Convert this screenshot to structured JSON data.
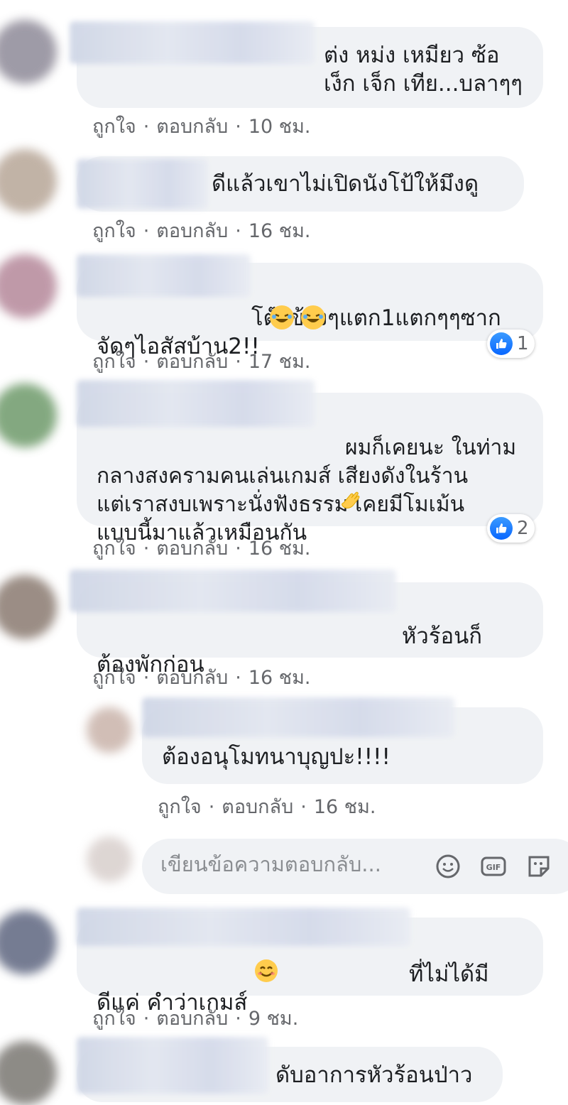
{
  "comments": [
    {
      "text": "ต่ง หม่ง เหมียว ซ้อ\nเง็ก เจ็ก เทีย...บลาๆๆ",
      "like_label": "ถูกใจ",
      "reply_label": "ตอบกลับ",
      "time": "10 ชม."
    },
    {
      "text": "ดีแล้วเขาไม่เปิดนังโป้ให้มึงดู",
      "like_label": "ถูกใจ",
      "reply_label": "ตอบกลับ",
      "time": "16 ชม."
    },
    {
      "text": "โต๊ะข้างๆแตก1แตกๆๆซาก\nจัดๆไอสัสบ้าน2!!",
      "like_label": "ถูกใจ",
      "reply_label": "ตอบกลับ",
      "time": "17 ชม.",
      "reactions": "1"
    },
    {
      "text": "ผมก็เคยนะ ในท่าม\nกลางสงครามคนเล่นเกมส์ เสียงดังในร้าน\nแต่เราสงบเพราะนั่งฟังธรรม เคยมีโมเม้น\nแบบนี้มาแล้วเหมือนกัน",
      "like_label": "ถูกใจ",
      "reply_label": "ตอบกลับ",
      "time": "16 ชม.",
      "reactions": "2"
    },
    {
      "text": "หัวร้อนก็\nต้องพักก่อน",
      "like_label": "ถูกใจ",
      "reply_label": "ตอบกลับ",
      "time": "16 ชม."
    }
  ],
  "reply": {
    "text": "ต้องอนุโมทนาบุญปะ!!!!",
    "like_label": "ถูกใจ",
    "reply_label": "ตอบกลับ",
    "time": "16 ชม."
  },
  "reply_input": {
    "placeholder": "เขียนข้อความตอบกลับ..."
  },
  "comments_after": [
    {
      "text": "ที่ไม่ได้มี\nดีแค่ คำว่าเกมส์",
      "like_label": "ถูกใจ",
      "reply_label": "ตอบกลับ",
      "time": "9 ชม."
    },
    {
      "text": "ดับอาการหัวร้อนป่าว"
    }
  ],
  "colors": {
    "bubble": "#f0f2f5",
    "meta_text": "#65676b",
    "like_blue": "#0866ff"
  }
}
